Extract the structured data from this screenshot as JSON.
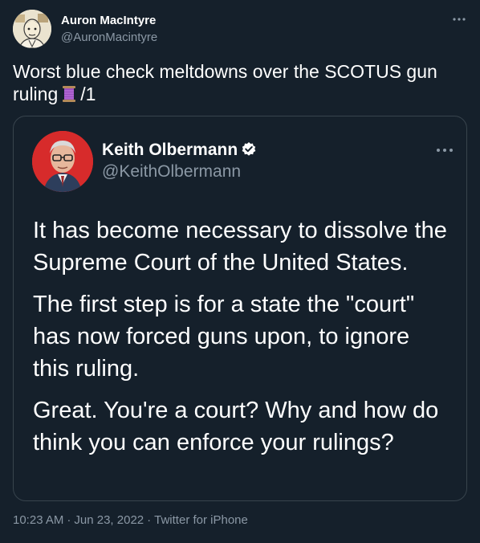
{
  "tweet": {
    "author_name": "Auron MacIntyre",
    "author_handle": "@AuronMacintyre",
    "text_line1": "Worst blue check meltdowns over the SCOTUS gun",
    "text_line2_before": "ruling",
    "text_line2_after": "/1",
    "thread_icon": "spool-of-thread-emoji"
  },
  "quoted_tweet": {
    "author_name": "Keith Olbermann",
    "author_handle": "@KeithOlbermann",
    "verified": true,
    "paragraphs": [
      "It has become necessary to dissolve the Supreme Court of the United States.",
      "The first step is for a state the \"court\" has now forced guns upon, to ignore this ruling.",
      "Great. You're a court? Why and how do think you can enforce your rulings?"
    ]
  },
  "footer": {
    "time": "10:23 AM",
    "date": "Jun 23, 2022",
    "source": "Twitter for iPhone"
  },
  "colors": {
    "background": "#15202b",
    "border": "#38444d",
    "secondary_text": "#8b98a5",
    "verified_badge": "#ffffff",
    "quoted_avatar_bg": "#d72b2b"
  }
}
